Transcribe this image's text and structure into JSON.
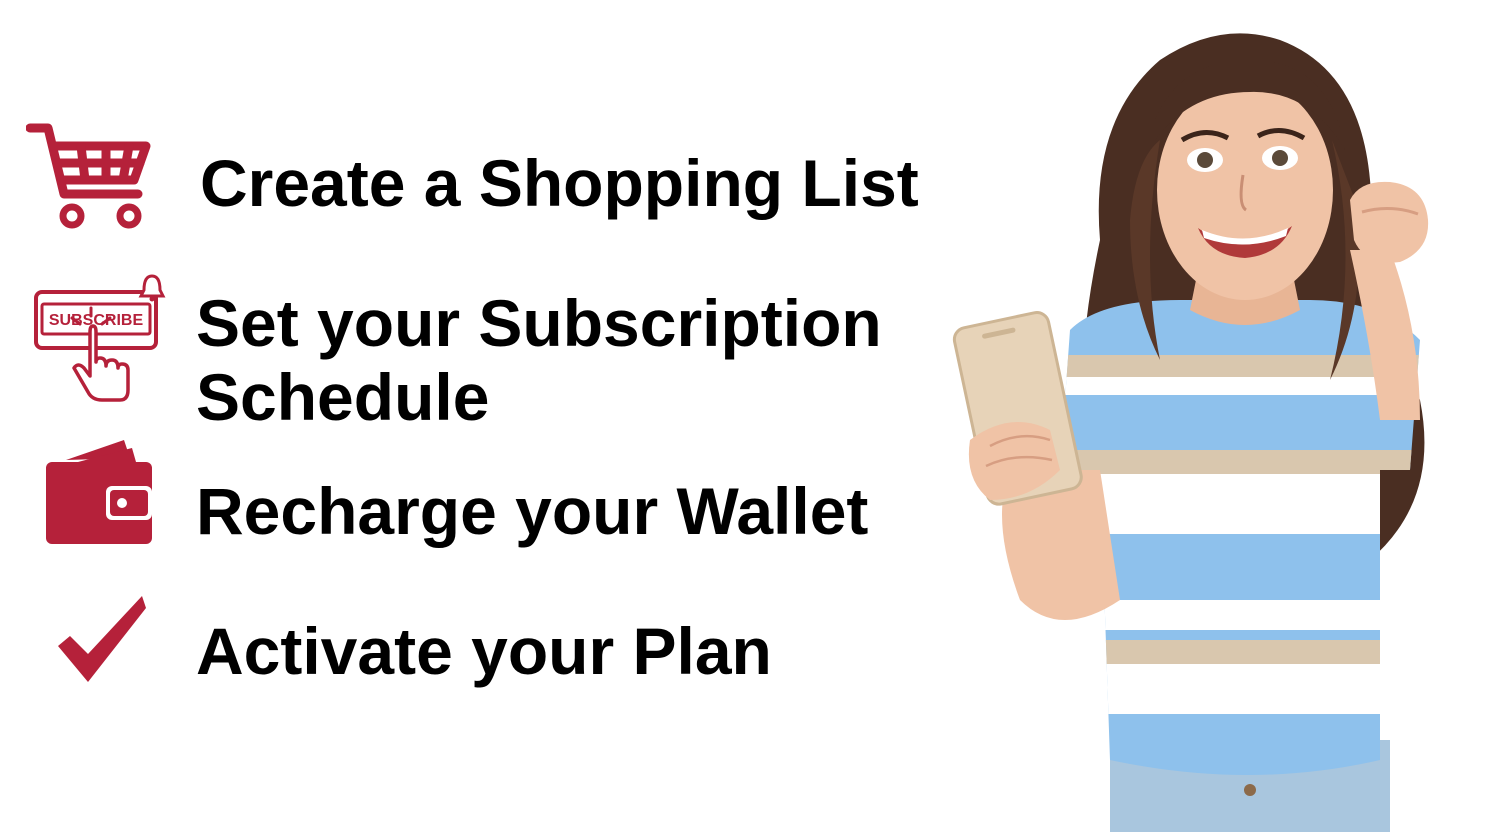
{
  "steps": [
    {
      "icon": "shopping-cart-icon",
      "line1": "Create a Shopping List",
      "line2": ""
    },
    {
      "icon": "subscribe-click-icon",
      "badge_text": "SUBSCRIBE",
      "line1": "Set your Subscription",
      "line2": "Schedule"
    },
    {
      "icon": "wallet-icon",
      "line1": "Recharge your Wallet",
      "line2": ""
    },
    {
      "icon": "checkmark-icon",
      "line1": "Activate your Plan",
      "line2": ""
    }
  ],
  "colors": {
    "accent": "#B5213A",
    "text": "#000000",
    "background": "#FFFFFF",
    "shirt_blue": "#8EC1EC",
    "shirt_beige": "#D9C7AE",
    "hair": "#4A2E22",
    "skin": "#F0C3A6",
    "phone": "#E7D3B8",
    "jeans": "#A9C6DE"
  }
}
